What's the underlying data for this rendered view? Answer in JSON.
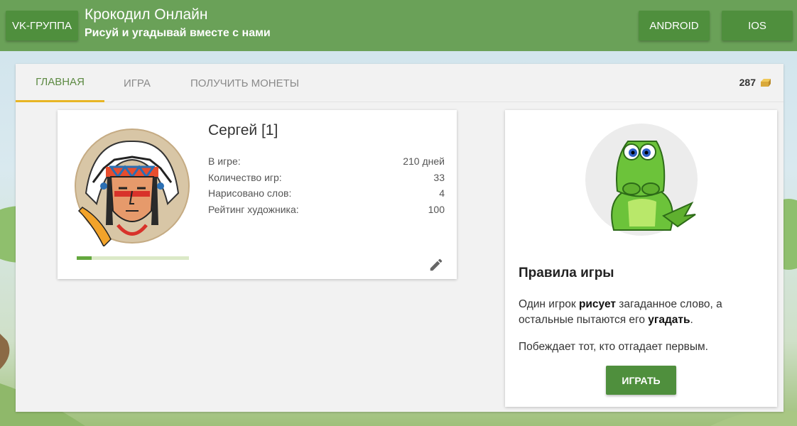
{
  "header": {
    "vk_button": "VK-ГРУППА",
    "title": "Крокодил Онлайн",
    "subtitle": "Рисуй и угадывай вместе с нами",
    "android_button": "ANDROID",
    "ios_button": "IOS"
  },
  "tabs": [
    {
      "label": "ГЛАВНАЯ",
      "active": true
    },
    {
      "label": "ИГРА",
      "active": false
    },
    {
      "label": "ПОЛУЧИТЬ МОНЕТЫ",
      "active": false
    }
  ],
  "coins": {
    "value": "287",
    "icon": "coin-stack-icon"
  },
  "profile": {
    "name": "Сергей [1]",
    "avatar": "indian-chief-avatar",
    "level_progress": 0.13,
    "stats": [
      {
        "label": "В игре:",
        "value": "210 дней"
      },
      {
        "label": "Количество игр:",
        "value": "33"
      },
      {
        "label": "Нарисовано слов:",
        "value": "4"
      },
      {
        "label": "Рейтинг художника:",
        "value": "100"
      }
    ],
    "edit_icon": "pencil-icon"
  },
  "rules": {
    "image": "crocodile-mascot",
    "title": "Правила игры",
    "text_part1": "Один игрок ",
    "text_bold1": "рисует",
    "text_part2": " загаданное слово, а остальные пытаются его ",
    "text_bold2": "угадать",
    "text_part3": ".",
    "text2": "Побеждает тот, кто отгадает первым.",
    "play_button": "ИГРАТЬ"
  },
  "colors": {
    "topbar": "#6aa158",
    "button_green": "#4f8f3d",
    "active_tab_text": "#5d8a43",
    "active_tab_underline": "#e8b524",
    "progress_fill": "#64a83e"
  }
}
